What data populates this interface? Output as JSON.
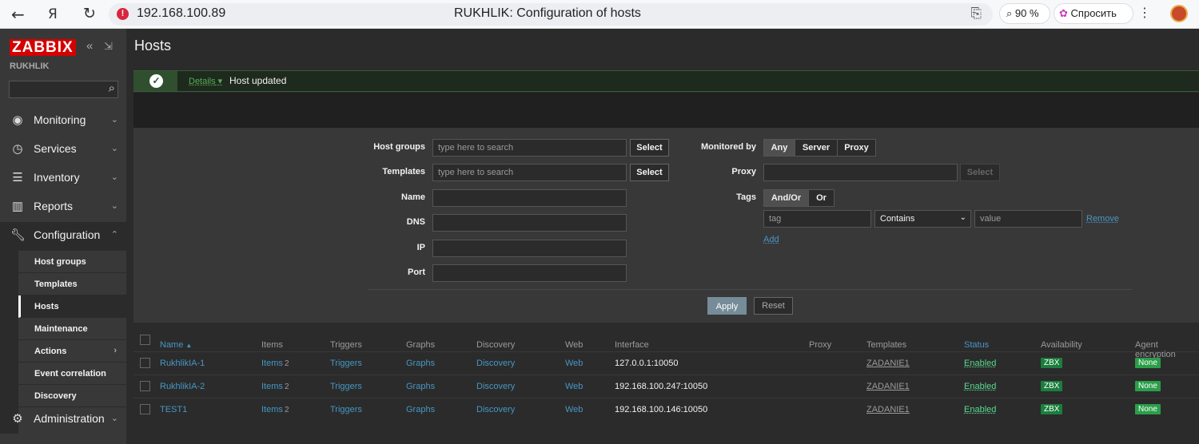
{
  "browser": {
    "url": "192.168.100.89",
    "title": "RUKHLIK: Configuration of hosts",
    "zoom": "90 %",
    "ask_label": "Спросить"
  },
  "sidebar": {
    "logo": "ZABBIX",
    "server_name": "RUKHLIK",
    "menu": [
      {
        "label": "Monitoring",
        "icon": "eye-icon"
      },
      {
        "label": "Services",
        "icon": "clock-icon"
      },
      {
        "label": "Inventory",
        "icon": "list-icon"
      },
      {
        "label": "Reports",
        "icon": "bar-chart-icon"
      },
      {
        "label": "Configuration",
        "icon": "wrench-icon"
      },
      {
        "label": "Administration",
        "icon": "gear-icon"
      }
    ],
    "submenu": [
      "Host groups",
      "Templates",
      "Hosts",
      "Maintenance",
      "Actions",
      "Event correlation",
      "Discovery"
    ]
  },
  "page": {
    "title": "Hosts",
    "message": {
      "details": "Details",
      "text": "Host updated"
    }
  },
  "filter": {
    "host_groups_label": "Host groups",
    "templates_label": "Templates",
    "name_label": "Name",
    "dns_label": "DNS",
    "ip_label": "IP",
    "port_label": "Port",
    "search_placeholder": "type here to search",
    "select_label": "Select",
    "monitored_by_label": "Monitored by",
    "monitored_by_options": [
      "Any",
      "Server",
      "Proxy"
    ],
    "proxy_label": "Proxy",
    "tags_label": "Tags",
    "tags_options": [
      "And/Or",
      "Or"
    ],
    "tag_placeholder": "tag",
    "tag_operator": "Contains",
    "value_placeholder": "value",
    "remove_label": "Remove",
    "add_label": "Add",
    "apply_label": "Apply",
    "reset_label": "Reset"
  },
  "table": {
    "headers": [
      "Name",
      "Items",
      "Triggers",
      "Graphs",
      "Discovery",
      "Web",
      "Interface",
      "Proxy",
      "Templates",
      "Status",
      "Availability",
      "Agent encryption"
    ],
    "sort_arrow": "▲",
    "rows": [
      {
        "name": "RukhlikIA-1",
        "items": "Items",
        "items_count": "2",
        "triggers": "Triggers",
        "graphs": "Graphs",
        "discovery": "Discovery",
        "web": "Web",
        "interface": "127.0.0.1:10050",
        "templates": "ZADANIE1",
        "status": "Enabled",
        "availability": "ZBX",
        "encryption": "None"
      },
      {
        "name": "RukhlikIA-2",
        "items": "Items",
        "items_count": "2",
        "triggers": "Triggers",
        "graphs": "Graphs",
        "discovery": "Discovery",
        "web": "Web",
        "interface": "192.168.100.247:10050",
        "templates": "ZADANIE1",
        "status": "Enabled",
        "availability": "ZBX",
        "encryption": "None"
      },
      {
        "name": "TEST1",
        "items": "Items",
        "items_count": "2",
        "triggers": "Triggers",
        "graphs": "Graphs",
        "discovery": "Discovery",
        "web": "Web",
        "interface": "192.168.100.146:10050",
        "templates": "ZADANIE1",
        "status": "Enabled",
        "availability": "ZBX",
        "encryption": "None"
      }
    ]
  }
}
